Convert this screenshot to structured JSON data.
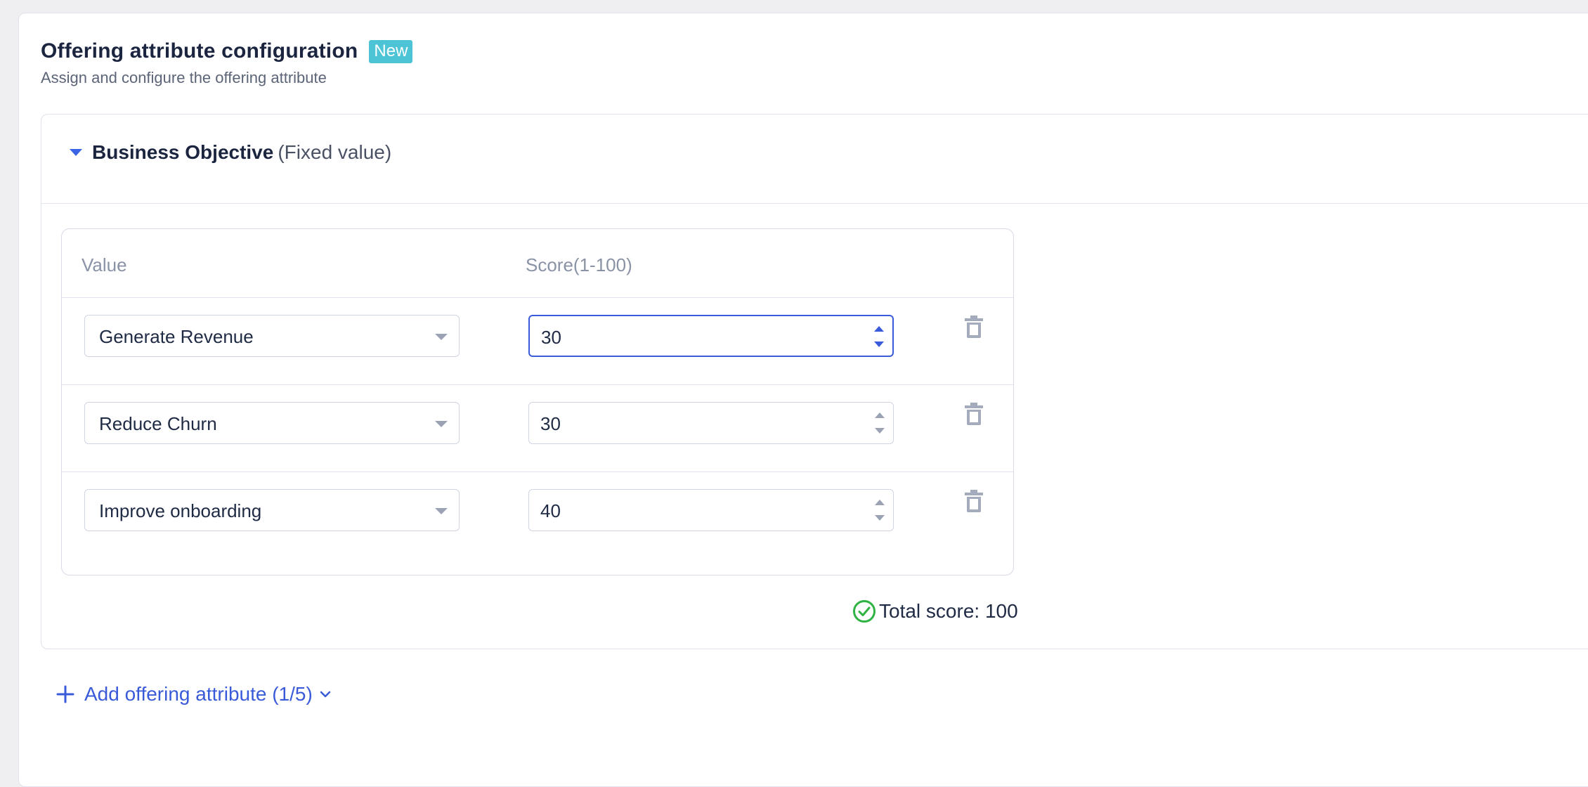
{
  "header": {
    "title": "Offering attribute configuration",
    "badge": "New",
    "subtitle": "Assign and configure the offering attribute"
  },
  "section": {
    "name": "Business Objective",
    "hint": "(Fixed value)",
    "expanded": true
  },
  "table": {
    "columns": [
      "Value",
      "Score(1-100)"
    ],
    "rows": [
      {
        "value": "Generate Revenue",
        "score": "30",
        "focused": true
      },
      {
        "value": "Reduce Churn",
        "score": "30",
        "focused": false
      },
      {
        "value": "Improve onboarding",
        "score": "40",
        "focused": false
      }
    ]
  },
  "total": {
    "label": "Total score: 100",
    "status": "valid"
  },
  "add": {
    "label": "Add offering attribute (1/5)"
  },
  "colors": {
    "accent": "#3a5bd9",
    "badge": "#4cc4d6",
    "success": "#2fb344",
    "muted": "#8a93a6"
  },
  "icons": [
    "caret-down-icon",
    "trash-icon",
    "check-circle-icon",
    "plus-icon",
    "chevron-down-icon"
  ]
}
